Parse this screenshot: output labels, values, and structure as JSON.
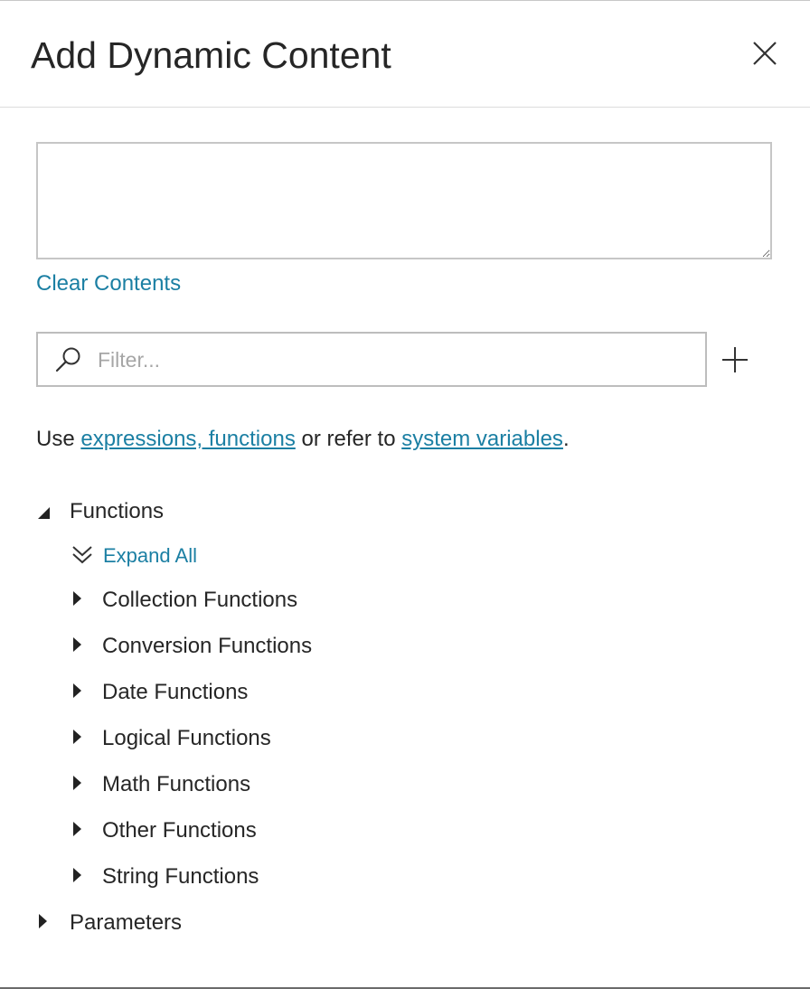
{
  "header": {
    "title": "Add Dynamic Content",
    "close_icon": "close-icon"
  },
  "expression": {
    "value": "",
    "clear_label": "Clear Contents"
  },
  "filter": {
    "placeholder": "Filter...",
    "icon": "search-icon",
    "add_icon": "plus-icon"
  },
  "help": {
    "prefix": "Use ",
    "link1": "expressions, functions",
    "middle": " or refer to ",
    "link2": "system variables",
    "suffix": "."
  },
  "tree": {
    "functions": {
      "label": "Functions",
      "expanded": true,
      "expand_all_label": "Expand All",
      "children": [
        {
          "label": "Collection Functions"
        },
        {
          "label": "Conversion Functions"
        },
        {
          "label": "Date Functions"
        },
        {
          "label": "Logical Functions"
        },
        {
          "label": "Math Functions"
        },
        {
          "label": "Other Functions"
        },
        {
          "label": "String Functions"
        }
      ]
    },
    "parameters": {
      "label": "Parameters",
      "expanded": false
    }
  },
  "colors": {
    "link": "#1b7fa3",
    "text": "#262626",
    "border": "#c6c6c6"
  }
}
